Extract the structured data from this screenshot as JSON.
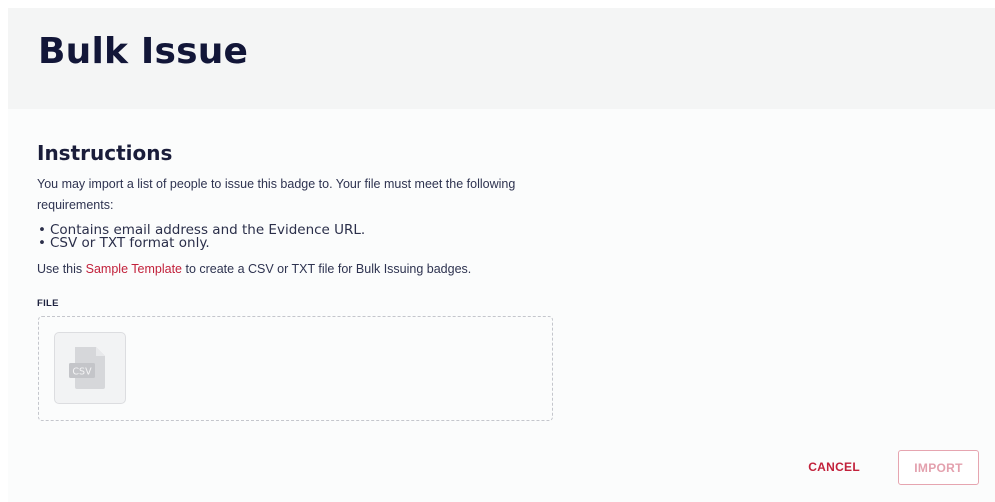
{
  "header": {
    "title": "Bulk Issue"
  },
  "instructions": {
    "heading": "Instructions",
    "intro": "You may import a list of people to issue this badge to. Your file must meet the following requirements:",
    "requirements": [
      "Contains email address and the Evidence URL.",
      "CSV or TXT format only."
    ],
    "template_prefix": "Use this ",
    "template_link_label": "Sample Template",
    "template_suffix": " to create a CSV or TXT file for Bulk Issuing badges."
  },
  "file_field": {
    "label": "FILE",
    "file_type_badge": "CSV",
    "icon": "csv-file-icon"
  },
  "actions": {
    "cancel_label": "CANCEL",
    "import_label": "IMPORT"
  },
  "colors": {
    "accent": "#c2213b",
    "import_disabled": "#e3a0ad",
    "header_bg": "#f4f5f5",
    "title_text": "#121638"
  }
}
